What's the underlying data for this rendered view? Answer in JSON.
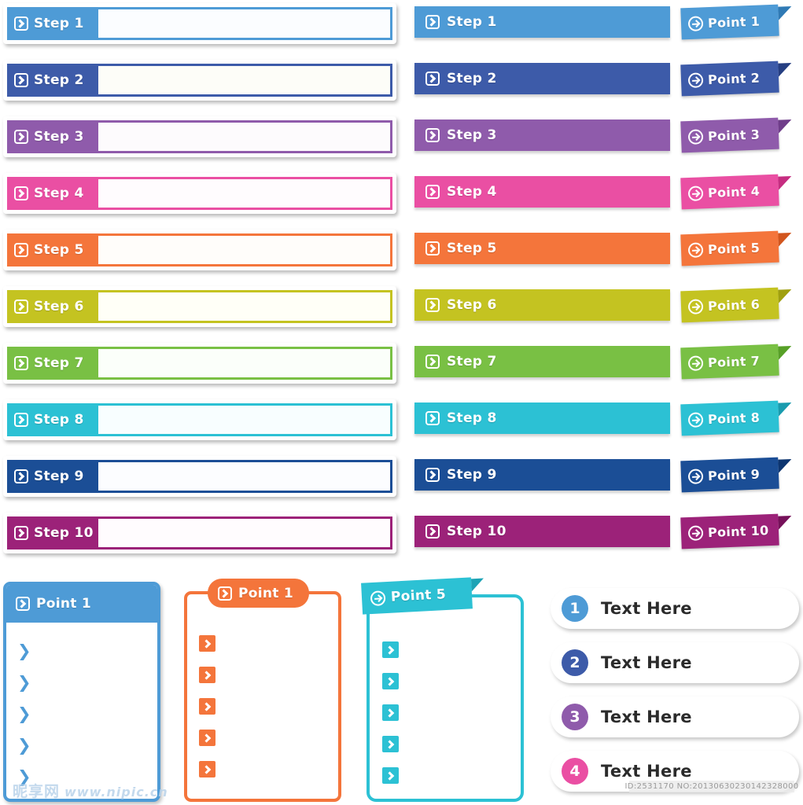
{
  "palette": {
    "blue_light": "#4e9bd6",
    "blue_royal": "#3d5ba9",
    "purple": "#8f5bab",
    "pink": "#ea4fa3",
    "orange": "#f4753b",
    "olive": "#c4c321",
    "green": "#79c044",
    "cyan": "#2cc1d4",
    "navy": "#1b4e96",
    "magenta": "#9c2279"
  },
  "steps_outlined": [
    {
      "label": "Step 1",
      "color": "#4e9bd6",
      "field": "#fbfdff"
    },
    {
      "label": "Step 2",
      "color": "#3d5ba9",
      "field": "#fdfdf8"
    },
    {
      "label": "Step 3",
      "color": "#8f5bab",
      "field": "#fdfbfd"
    },
    {
      "label": "Step 4",
      "color": "#ea4fa3",
      "field": "#fffcfe"
    },
    {
      "label": "Step 5",
      "color": "#f4753b",
      "field": "#fffdfa"
    },
    {
      "label": "Step 6",
      "color": "#c4c321",
      "field": "#fffff7"
    },
    {
      "label": "Step 7",
      "color": "#79c044",
      "field": "#fbfffa"
    },
    {
      "label": "Step 8",
      "color": "#2cc1d4",
      "field": "#f8feff"
    },
    {
      "label": "Step 9",
      "color": "#1b4e96",
      "field": "#fcfdff"
    },
    {
      "label": "Step 10",
      "color": "#9c2279",
      "field": "#fffcfe"
    }
  ],
  "steps_solid": [
    {
      "label": "Step 1",
      "color": "#4e9bd6"
    },
    {
      "label": "Step 2",
      "color": "#3d5ba9"
    },
    {
      "label": "Step 3",
      "color": "#8f5bab"
    },
    {
      "label": "Step 4",
      "color": "#ea4fa3"
    },
    {
      "label": "Step 5",
      "color": "#f4753b"
    },
    {
      "label": "Step 6",
      "color": "#c4c321"
    },
    {
      "label": "Step 7",
      "color": "#79c044"
    },
    {
      "label": "Step 8",
      "color": "#2cc1d4"
    },
    {
      "label": "Step 9",
      "color": "#1b4e96"
    },
    {
      "label": "Step 10",
      "color": "#9c2279"
    }
  ],
  "point_ribbons": [
    {
      "label": "Point 1",
      "color": "#4e9bd6",
      "dark": "#2f7ab5"
    },
    {
      "label": "Point 2",
      "color": "#3d5ba9",
      "dark": "#253e82"
    },
    {
      "label": "Point 3",
      "color": "#8f5bab",
      "dark": "#6f3d8a"
    },
    {
      "label": "Point 4",
      "color": "#ea4fa3",
      "dark": "#c62d81"
    },
    {
      "label": "Point 5",
      "color": "#f4753b",
      "dark": "#d2551d"
    },
    {
      "label": "Point 6",
      "color": "#c4c321",
      "dark": "#a0a00f"
    },
    {
      "label": "Point 7",
      "color": "#79c044",
      "dark": "#57a027"
    },
    {
      "label": "Point 8",
      "color": "#2cc1d4",
      "dark": "#189bae"
    },
    {
      "label": "Point 9",
      "color": "#1b4e96",
      "dark": "#0d3570"
    },
    {
      "label": "Point 10",
      "color": "#9c2279",
      "dark": "#76115a"
    }
  ],
  "card_blue": {
    "title": "Point 1",
    "color": "#4e9bd6",
    "bullets": [
      "",
      "",
      "",
      "",
      ""
    ]
  },
  "card_orange": {
    "title": "Point 1",
    "color": "#f4753b",
    "bullets": [
      "",
      "",
      "",
      "",
      ""
    ]
  },
  "card_teal": {
    "title": "Point 5",
    "color": "#2cc1d4",
    "bullets": [
      "",
      "",
      "",
      "",
      ""
    ]
  },
  "numbered_pills": [
    {
      "number": "1",
      "label": "Text Here",
      "color": "#4e9bd6"
    },
    {
      "number": "2",
      "label": "Text Here",
      "color": "#3d5ba9"
    },
    {
      "number": "3",
      "label": "Text Here",
      "color": "#8f5bab"
    },
    {
      "number": "4",
      "label": "Text Here",
      "color": "#ea4fa3"
    }
  ],
  "watermark": {
    "brand": "昵享网",
    "url": "www.nipic.cn",
    "id_line": "ID:2531170 NO:20130630230142328000"
  }
}
